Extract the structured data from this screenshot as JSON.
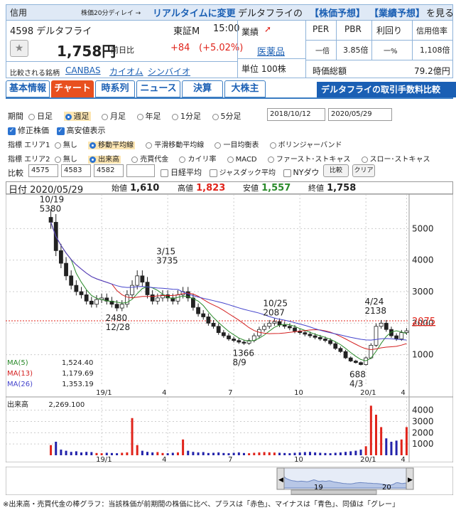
{
  "header": {
    "margin_label": "信用",
    "delay_text": "株価20分ディレイ →",
    "realtime_link": "リアルタイムに変更",
    "company_forecast_prefix": "デルタフライの",
    "forecast_link": "【株価予想】",
    "performance_link": "【業績予想】",
    "view_text": "を見る"
  },
  "stock": {
    "code_name": "4598 デルタフライ",
    "market": "東証M",
    "time": "15:00",
    "price": "1,758円",
    "change_label": "前日比",
    "change": "+84",
    "change_pct": "(+5.02%)",
    "compare_label": "比較される銘柄",
    "compare": [
      "CANBAS",
      "カイオム",
      "シンバイオ"
    ],
    "performance_label": "業績",
    "sector": "医薬品",
    "unit": "単位 100株",
    "market_cap_label": "時価総額",
    "market_cap": "79.2億円"
  },
  "indicators": {
    "headers": [
      "PER",
      "PBR",
      "利回り",
      "信用倍率"
    ],
    "values": [
      "一倍",
      "3.85倍",
      "一%",
      "1,108倍"
    ]
  },
  "tabs": [
    "基本情報",
    "チャート",
    "時系列",
    "ニュース",
    "決算",
    "大株主"
  ],
  "promo": "デルタフライの取引手数料比較",
  "controls": {
    "period_label": "期間",
    "periods": [
      "日足",
      "週足",
      "月足",
      "年足",
      "1分足",
      "5分足"
    ],
    "date_from": "2018/10/12",
    "date_to": "2020/05/29",
    "adjusted": "修正株価",
    "highlow": "高安値表示",
    "ind1_label": "指標 エリア1",
    "ind1": [
      "無し",
      "移動平均線",
      "平滑移動平均線",
      "一目均衡表",
      "ボリンジャーバンド"
    ],
    "ind2_label": "指標 エリア2",
    "ind2": [
      "無し",
      "出来高",
      "売買代金",
      "カイリ率",
      "MACD",
      "ファースト･ストキャス",
      "スロー･ストキャス"
    ],
    "compare_label": "比較",
    "compare_codes": [
      "4575",
      "4583",
      "4582",
      ""
    ],
    "compare_checks": [
      "日経平均",
      "ジャスダック平均",
      "NYダウ"
    ],
    "compare_button": "比較",
    "clear_button": "クリア"
  },
  "ohlc": {
    "date_label": "日付",
    "date": "2020/05/29",
    "open_label": "始値",
    "open": "1,610",
    "high_label": "高値",
    "high": "1,823",
    "low_label": "安値",
    "low": "1,557",
    "close_label": "終値",
    "close": "1,758"
  },
  "chart_data": {
    "type": "candlestick",
    "yticks": [
      1000,
      2000,
      3000,
      4000,
      5000
    ],
    "ylim": [
      0,
      6000
    ],
    "xticks": [
      "19/1",
      "4",
      "7",
      "10",
      "20/1",
      "4"
    ],
    "current_price_label": "2075",
    "annotations": [
      {
        "date": "10/19",
        "value": "5380"
      },
      {
        "date": "3/15",
        "value": "3735"
      },
      {
        "date": "12/28",
        "value": "2480"
      },
      {
        "date": "8/9",
        "value": "1366"
      },
      {
        "date": "10/25",
        "value": "2087"
      },
      {
        "date": "4/24",
        "value": "2138"
      },
      {
        "date": "4/3",
        "value": "688"
      }
    ],
    "ma_legend": [
      {
        "name": "MA(5)",
        "value": "1,524.40",
        "color": "#2a8a2a"
      },
      {
        "name": "MA(13)",
        "value": "1,179.69",
        "color": "#d42020"
      },
      {
        "name": "MA(26)",
        "value": "1,353.19",
        "color": "#4444cc"
      }
    ],
    "weekly_close": [
      5200,
      4300,
      3900,
      3500,
      3200,
      3000,
      2900,
      2700,
      2600,
      2750,
      2800,
      2700,
      2600,
      2480,
      2600,
      2900,
      3200,
      3500,
      3300,
      2900,
      2700,
      2800,
      2900,
      2800,
      2700,
      2900,
      3000,
      2800,
      2500,
      2300,
      2200,
      2000,
      1900,
      1700,
      1600,
      1500,
      1450,
      1400,
      1366,
      1450,
      1600,
      1800,
      1900,
      2000,
      2050,
      1950,
      1900,
      1850,
      1750,
      1700,
      1650,
      1600,
      1550,
      1500,
      1450,
      1350,
      1200,
      1100,
      900,
      800,
      750,
      688,
      900,
      1300,
      1900,
      2000,
      1800,
      1600,
      1500,
      1700,
      1758
    ],
    "volume_label": "出来高",
    "volume_value": "2,269.100",
    "volume_yticks": [
      1000,
      2000,
      3000,
      4000
    ],
    "volume_ylim": [
      0,
      4800
    ],
    "weekly_volume": [
      900,
      1200,
      500,
      400,
      300,
      350,
      250,
      300,
      280,
      200,
      180,
      220,
      200,
      180,
      220,
      250,
      3300,
      900,
      400,
      300,
      250,
      280,
      200,
      180,
      220,
      250,
      1400,
      400,
      300,
      250,
      280,
      200,
      220,
      250,
      200,
      180,
      220,
      250,
      200,
      180,
      220,
      250,
      280,
      260,
      240,
      220,
      200,
      180,
      220,
      250,
      280,
      300,
      250,
      220,
      200,
      180,
      220,
      250,
      300,
      350,
      400,
      500,
      800,
      4400,
      3600,
      2500,
      1500,
      1200,
      1300,
      1400,
      2500
    ],
    "volume_up": [
      true,
      false,
      false,
      false,
      false,
      false,
      false,
      false,
      false,
      true,
      true,
      false,
      false,
      false,
      true,
      true,
      true,
      true,
      false,
      false,
      false,
      true,
      true,
      false,
      false,
      true,
      true,
      false,
      false,
      false,
      false,
      false,
      false,
      false,
      false,
      false,
      false,
      false,
      false,
      true,
      true,
      true,
      true,
      true,
      true,
      false,
      false,
      false,
      false,
      false,
      false,
      false,
      false,
      false,
      false,
      false,
      false,
      false,
      false,
      false,
      false,
      false,
      true,
      true,
      true,
      true,
      false,
      false,
      false,
      true,
      true
    ],
    "navigator_xticks": [
      "19",
      "20"
    ]
  },
  "footer": "※出来高・売買代金の棒グラフ：当該株価が前期間の株価に比べ、プラスは「赤色」、マイナスは「青色」、同値は「グレー」"
}
